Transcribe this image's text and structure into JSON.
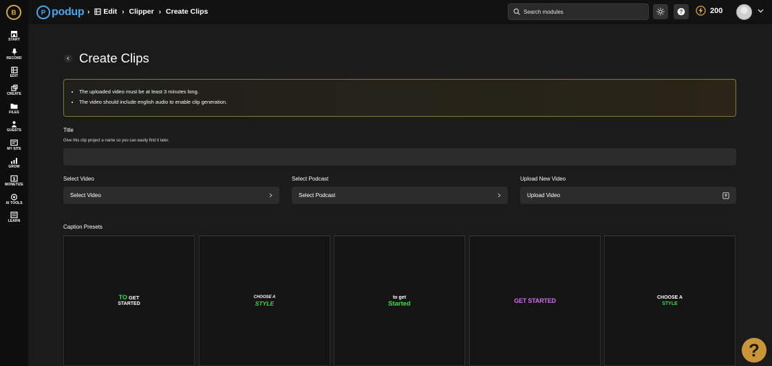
{
  "sidebar": {
    "items": [
      {
        "label": "START",
        "icon": "store-icon"
      },
      {
        "label": "RECORD",
        "icon": "microphone-icon"
      },
      {
        "label": "EDIT",
        "icon": "film-icon"
      },
      {
        "label": "CREATE",
        "icon": "create-icon"
      },
      {
        "label": "FILES",
        "icon": "folder-icon"
      },
      {
        "label": "GUESTS",
        "icon": "guests-icon"
      },
      {
        "label": "MY SITE",
        "icon": "site-icon"
      },
      {
        "label": "GROW",
        "icon": "chart-icon"
      },
      {
        "label": "MONETIZE",
        "icon": "monetize-icon"
      },
      {
        "label": "AI TOOLS",
        "icon": "ai-icon"
      },
      {
        "label": "LEARN",
        "icon": "learn-icon"
      }
    ]
  },
  "header": {
    "brand": "podup",
    "breadcrumbs": [
      "Edit",
      "Clipper",
      "Create Clips"
    ],
    "search_placeholder": "Search modules",
    "credits": "200"
  },
  "page": {
    "title": "Create Clips",
    "notices": [
      "The uploaded video must be at least 3 minutes long.",
      "The video should include english audio to enable clip generation."
    ],
    "title_field": {
      "label": "Title",
      "hint": "Give this clip project a name so you can easily find it later.",
      "value": ""
    },
    "select_video": {
      "label": "Select Video",
      "value": "Select Video"
    },
    "select_podcast": {
      "label": "Select Podcast",
      "value": "Select Podcast"
    },
    "upload_video": {
      "label": "Upload New Video",
      "value": "Upload Video"
    },
    "caption_presets_label": "Caption Presets",
    "presets": [
      {
        "lines": [
          "TO GET",
          "STARTED"
        ],
        "accent": "TO"
      },
      {
        "lines": [
          "CHOOSE A",
          "STYLE"
        ]
      },
      {
        "lines": [
          "to get",
          "Started"
        ]
      },
      {
        "lines": [
          "GET STARTED"
        ]
      },
      {
        "lines": [
          "CHOOSE A",
          "STYLE"
        ]
      }
    ]
  },
  "colors": {
    "accent_gold": "#d4a94a",
    "brand_blue": "#4da6e8",
    "preset_green": "#3ddc4a",
    "preset_pink": "#d56cf0",
    "help_bubble": "#c9943a"
  }
}
